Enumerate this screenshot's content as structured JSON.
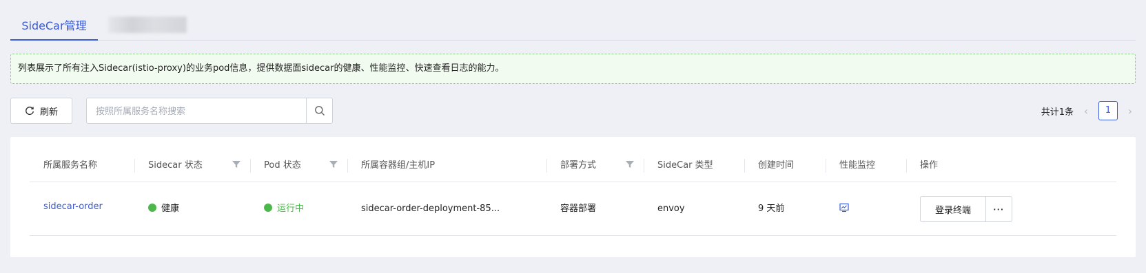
{
  "tabs": [
    {
      "label": "SideCar管理",
      "active": true
    },
    {
      "label": "",
      "active": false
    }
  ],
  "notice": {
    "text": "列表展示了所有注入Sidecar(istio-proxy)的业务pod信息，提供数据面sidecar的健康、性能监控、快速查看日志的能力。"
  },
  "toolbar": {
    "refresh_label": "刷新",
    "search_placeholder": "按照所属服务名称搜索",
    "search_value": ""
  },
  "pager": {
    "total_text": "共计1条",
    "current_page": "1"
  },
  "table": {
    "columns": [
      "所属服务名称",
      "Sidecar 状态",
      "Pod 状态",
      "所属容器组/主机IP",
      "部署方式",
      "SideCar 类型",
      "创建时间",
      "性能监控",
      "操作"
    ],
    "rows": [
      {
        "service": "sidecar-order",
        "sidecar_status": "健康",
        "pod_status": "运行中",
        "pod_host": "sidecar-order-deployment-85...",
        "deploy_mode": "容器部署",
        "sidecar_type": "envoy",
        "created": "9 天前",
        "login_label": "登录终端",
        "more_label": "···"
      }
    ]
  },
  "colors": {
    "accent": "#3a5bd9",
    "success": "#4cb84c",
    "notice_bg": "#f1fbef",
    "notice_border": "#8fd08a"
  },
  "icons": [
    "refresh-icon",
    "search-icon",
    "filter-icon",
    "monitor-icon",
    "chevron-left-icon",
    "chevron-right-icon",
    "more-icon"
  ]
}
